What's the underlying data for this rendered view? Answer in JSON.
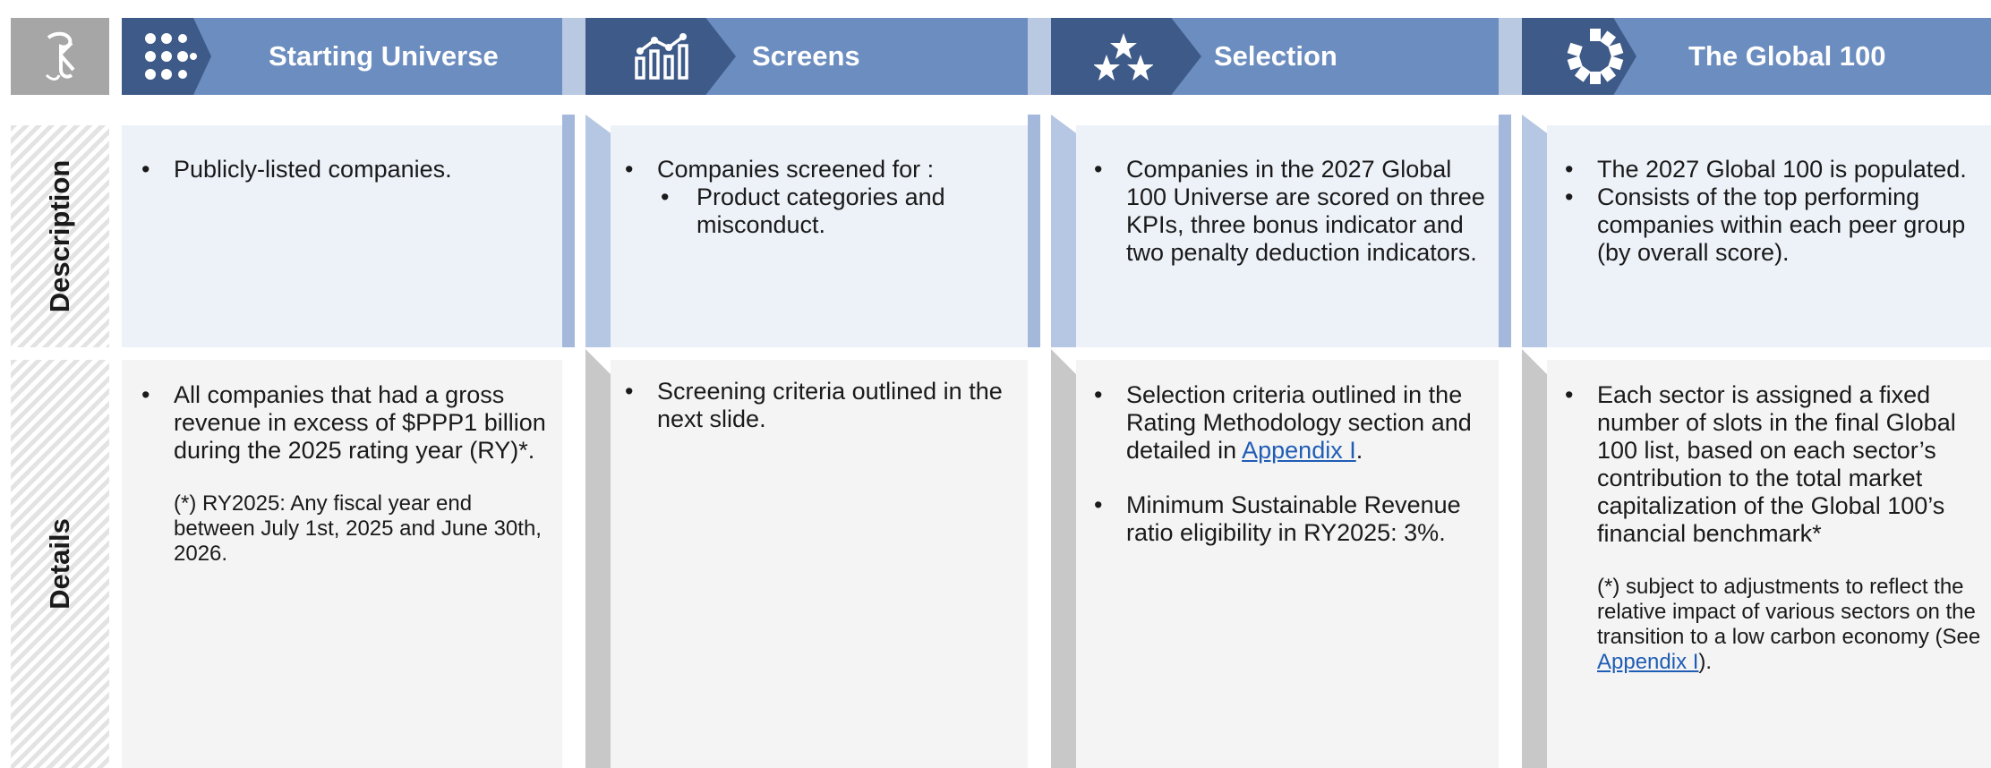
{
  "header": {
    "stages": [
      {
        "label": "Starting Universe",
        "icon": "dot-grid-icon"
      },
      {
        "label": "Screens",
        "icon": "filter-chart-icon"
      },
      {
        "label": "Selection",
        "icon": "stars-icon"
      },
      {
        "label": "The Global 100",
        "icon": "ring-icon"
      }
    ],
    "colors": {
      "light": "#6c8dc0",
      "dark": "#3e5a88",
      "logo_bg": "#a6a6a6"
    }
  },
  "rows": {
    "description_label": "Description",
    "details_label": "Details"
  },
  "description": {
    "starting_universe": [
      "Publicly-listed companies."
    ],
    "screens_main": "Companies screened for :",
    "screens_sub": "Product categories and misconduct.",
    "selection": "Companies in the 2027 Global 100 Universe are scored on three KPIs, three bonus indicator and two penalty deduction indicators.",
    "global100": [
      "The 2027 Global 100 is populated.",
      "Consists of the top performing companies within each peer group (by overall score)."
    ]
  },
  "details": {
    "starting_universe_main": "All companies that had a gross revenue in excess of $PPP1 billion during the 2025 rating year (RY)*.",
    "starting_universe_note": "(*) RY2025: Any fiscal year end between July 1st, 2025 and June 30th, 2026.",
    "screens": "Screening criteria outlined in the next slide.",
    "selection_1_text": "Selection criteria outlined in the Rating Methodology section and detailed in",
    "selection_1_link": "Appendix I",
    "selection_1_end": ".",
    "selection_2": "Minimum Sustainable Revenue ratio eligibility in RY2025: 3%.",
    "global100_main": "Each sector is assigned a fixed number of slots in the final Global 100 list, based on each sector’s contribution to the total market capitalization of the Global 100’s financial benchmark*",
    "global100_note_text": "(*) subject to adjustments to reflect the relative impact of various sectors on the transition to a low carbon economy (See",
    "global100_note_link": "Appendix I",
    "global100_note_end": ")."
  }
}
